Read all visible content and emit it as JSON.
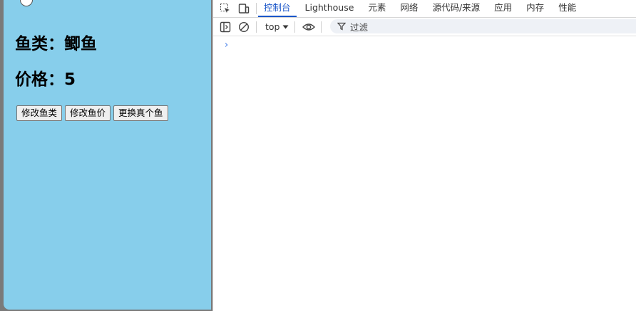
{
  "app": {
    "kind_label": "鱼类：鲫鱼",
    "price_label": "价格：5",
    "buttons": {
      "change_kind": "修改鱼类",
      "change_price": "修改鱼价",
      "replace_fish": "更换真个鱼"
    }
  },
  "devtools": {
    "tabs": [
      "控制台",
      "Lighthouse",
      "元素",
      "网络",
      "源代码/来源",
      "应用",
      "内存",
      "性能"
    ],
    "active_tab": "控制台",
    "context_selector": "top",
    "filter_placeholder": "过滤",
    "prompt_symbol": "›",
    "accent_color": "#1a56c9"
  },
  "colors": {
    "app_background": "#87ceeb"
  }
}
